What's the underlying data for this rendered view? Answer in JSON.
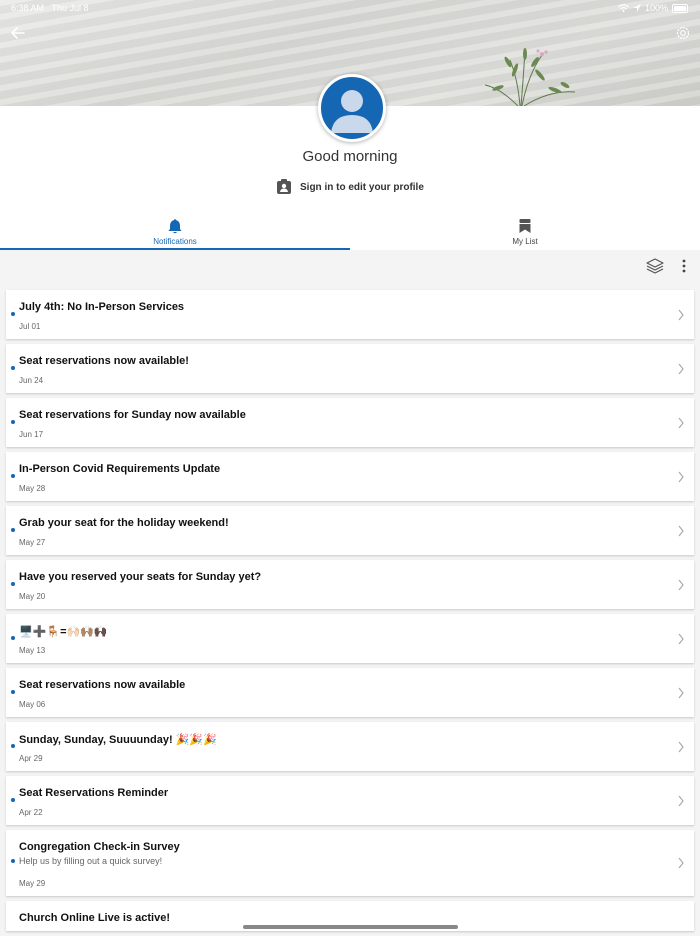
{
  "status_bar": {
    "time": "6:38 AM",
    "date": "Thu Jul 8",
    "battery": "100%"
  },
  "profile": {
    "greeting": "Good morning",
    "signin_label": "Sign in to edit your profile"
  },
  "tabs": [
    {
      "label": "Notifications",
      "icon": "bell-icon",
      "active": true
    },
    {
      "label": "My List",
      "icon": "bookmark-icon",
      "active": false
    }
  ],
  "notifications": [
    {
      "title": "July 4th: No In-Person Services",
      "date": "Jul 01"
    },
    {
      "title": "Seat reservations now available!",
      "date": "Jun 24"
    },
    {
      "title": "Seat reservations for Sunday now available",
      "date": "Jun 17"
    },
    {
      "title": "In-Person Covid Requirements Update",
      "date": "May 28"
    },
    {
      "title": "Grab your seat for the holiday weekend!",
      "date": "May 27"
    },
    {
      "title": "Have you reserved your seats for Sunday yet?",
      "date": "May 20"
    },
    {
      "title": "🖥️➕🪑=🙌🏻🙌🏽🙌🏿",
      "date": "May 13"
    },
    {
      "title": "Seat reservations now available",
      "date": "May 06"
    },
    {
      "title": "Sunday, Sunday, Suuuunday! 🎉🎉🎉",
      "date": "Apr 29"
    },
    {
      "title": "Seat Reservations Reminder",
      "date": "Apr 22"
    },
    {
      "title": "Congregation Check-in Survey",
      "subtitle": "Help us by filling out a quick survey!",
      "date": "May 29"
    },
    {
      "title": "Church Online Live is active!",
      "date": ""
    }
  ],
  "colors": {
    "accent": "#1567b3"
  }
}
